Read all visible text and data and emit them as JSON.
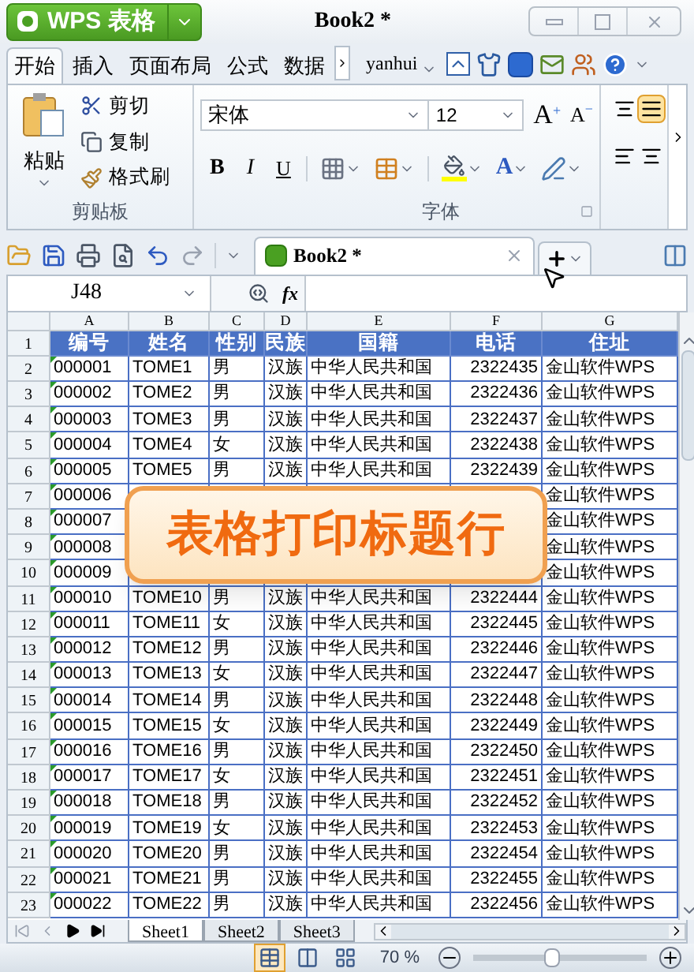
{
  "app_button": {
    "label": "WPS 表格"
  },
  "window": {
    "title": "Book2 *"
  },
  "menu_tabs": [
    {
      "label": "开始",
      "selected": true
    },
    {
      "label": "插入",
      "selected": false
    },
    {
      "label": "页面布局",
      "selected": false
    },
    {
      "label": "公式",
      "selected": false
    },
    {
      "label": "数据",
      "selected": false
    }
  ],
  "user": "yanhui",
  "clipboard": {
    "paste": "粘贴",
    "cut": "剪切",
    "copy": "复制",
    "format_painter": "格式刷",
    "group_label": "剪贴板"
  },
  "font": {
    "name": "宋体",
    "size": "12",
    "grow": "A",
    "grow_mark": "+",
    "shrink": "A",
    "shrink_mark": "−",
    "bold": "B",
    "italic": "I",
    "underline": "U",
    "color_letter": "A",
    "group_label": "字体"
  },
  "alignment": [
    {
      "selected": false
    },
    {
      "selected": true
    },
    {
      "selected": false
    },
    {
      "selected": false
    }
  ],
  "document_tab": {
    "title": "Book2 *"
  },
  "name_box": "J48",
  "formula_label": "fx",
  "columns": [
    "A",
    "B",
    "C",
    "D",
    "E",
    "F",
    "G"
  ],
  "rows": [
    {
      "number": "1",
      "kind": "header",
      "cells": [
        "编号",
        "姓名",
        "性别",
        "民族",
        "国籍",
        "电话",
        "住址"
      ]
    },
    {
      "number": "2",
      "kind": "data",
      "cells": [
        "000001",
        "TOME1",
        "男",
        "汉族",
        "中华人民共和国",
        "2322435",
        "金山软件WPS"
      ]
    },
    {
      "number": "3",
      "kind": "data",
      "cells": [
        "000002",
        "TOME2",
        "男",
        "汉族",
        "中华人民共和国",
        "2322436",
        "金山软件WPS"
      ]
    },
    {
      "number": "4",
      "kind": "data",
      "cells": [
        "000003",
        "TOME3",
        "男",
        "汉族",
        "中华人民共和国",
        "2322437",
        "金山软件WPS"
      ]
    },
    {
      "number": "5",
      "kind": "data",
      "cells": [
        "000004",
        "TOME4",
        "女",
        "汉族",
        "中华人民共和国",
        "2322438",
        "金山软件WPS"
      ]
    },
    {
      "number": "6",
      "kind": "data",
      "cells": [
        "000005",
        "TOME5",
        "男",
        "汉族",
        "中华人民共和国",
        "2322439",
        "金山软件WPS"
      ]
    },
    {
      "number": "7",
      "kind": "data",
      "cells": [
        "000006",
        null,
        null,
        null,
        null,
        null,
        "金山软件WPS"
      ]
    },
    {
      "number": "8",
      "kind": "data",
      "cells": [
        "000007",
        null,
        null,
        null,
        null,
        null,
        "金山软件WPS"
      ]
    },
    {
      "number": "9",
      "kind": "data",
      "cells": [
        "000008",
        null,
        null,
        null,
        null,
        null,
        "金山软件WPS"
      ]
    },
    {
      "number": "10",
      "kind": "data",
      "cells": [
        "000009",
        null,
        null,
        null,
        null,
        null,
        "金山软件WPS"
      ]
    },
    {
      "number": "11",
      "kind": "data",
      "cells": [
        "000010",
        "TOME10",
        "男",
        "汉族",
        "中华人民共和国",
        "2322444",
        "金山软件WPS"
      ]
    },
    {
      "number": "12",
      "kind": "data",
      "cells": [
        "000011",
        "TOME11",
        "女",
        "汉族",
        "中华人民共和国",
        "2322445",
        "金山软件WPS"
      ]
    },
    {
      "number": "13",
      "kind": "data",
      "cells": [
        "000012",
        "TOME12",
        "男",
        "汉族",
        "中华人民共和国",
        "2322446",
        "金山软件WPS"
      ]
    },
    {
      "number": "14",
      "kind": "data",
      "cells": [
        "000013",
        "TOME13",
        "女",
        "汉族",
        "中华人民共和国",
        "2322447",
        "金山软件WPS"
      ]
    },
    {
      "number": "15",
      "kind": "data",
      "cells": [
        "000014",
        "TOME14",
        "男",
        "汉族",
        "中华人民共和国",
        "2322448",
        "金山软件WPS"
      ]
    },
    {
      "number": "16",
      "kind": "data",
      "cells": [
        "000015",
        "TOME15",
        "女",
        "汉族",
        "中华人民共和国",
        "2322449",
        "金山软件WPS"
      ]
    },
    {
      "number": "17",
      "kind": "data",
      "cells": [
        "000016",
        "TOME16",
        "男",
        "汉族",
        "中华人民共和国",
        "2322450",
        "金山软件WPS"
      ]
    },
    {
      "number": "18",
      "kind": "data",
      "cells": [
        "000017",
        "TOME17",
        "女",
        "汉族",
        "中华人民共和国",
        "2322451",
        "金山软件WPS"
      ]
    },
    {
      "number": "19",
      "kind": "data",
      "cells": [
        "000018",
        "TOME18",
        "男",
        "汉族",
        "中华人民共和国",
        "2322452",
        "金山软件WPS"
      ]
    },
    {
      "number": "20",
      "kind": "data",
      "cells": [
        "000019",
        "TOME19",
        "女",
        "汉族",
        "中华人民共和国",
        "2322453",
        "金山软件WPS"
      ]
    },
    {
      "number": "21",
      "kind": "data",
      "cells": [
        "000020",
        "TOME20",
        "男",
        "汉族",
        "中华人民共和国",
        "2322454",
        "金山软件WPS"
      ]
    },
    {
      "number": "22",
      "kind": "data",
      "cells": [
        "000021",
        "TOME21",
        "男",
        "汉族",
        "中华人民共和国",
        "2322455",
        "金山软件WPS"
      ]
    },
    {
      "number": "23",
      "kind": "data",
      "cells": [
        "000022",
        "TOME22",
        "男",
        "汉族",
        "中华人民共和国",
        "2322456",
        "金山软件WPS"
      ]
    }
  ],
  "overlay_banner": "表格打印标题行",
  "sheet_tabs": [
    {
      "label": "Sheet1",
      "selected": true
    },
    {
      "label": "Sheet2",
      "selected": false
    },
    {
      "label": "Sheet3",
      "selected": false
    }
  ],
  "views": [
    {
      "selected": true
    },
    {
      "selected": false
    },
    {
      "selected": false
    }
  ],
  "zoom": {
    "reading": "70 %",
    "level": 0.45
  }
}
